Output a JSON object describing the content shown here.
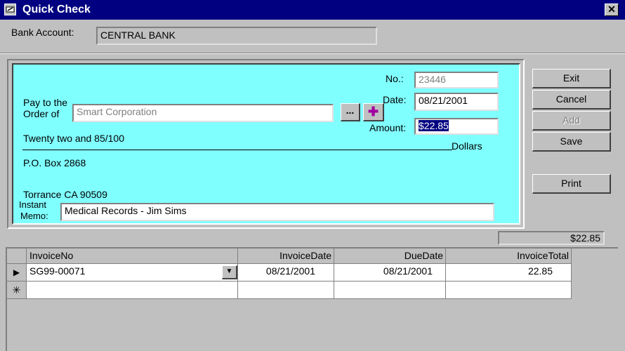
{
  "window": {
    "title": "Quick Check",
    "close_glyph": "✕"
  },
  "bank": {
    "label": "Bank Account:",
    "value": "CENTRAL BANK"
  },
  "check": {
    "no_label": "No.:",
    "no_value": "23446",
    "date_label": "Date:",
    "date_value": "08/21/2001",
    "pay_label_1": "Pay to the",
    "pay_label_2": "Order of",
    "payee_value": "Smart Corporation",
    "browse_label": "...",
    "add_payee_glyph": "✚",
    "amount_label": "Amount:",
    "amount_value": "$22.85",
    "amount_words": "Twenty two and 85/100",
    "dollars_label": "Dollars",
    "address_1": "P.O. Box 2868",
    "address_2": "Torrance CA 90509",
    "memo_label_1": "Instant",
    "memo_label_2": "Memo:",
    "memo_value": "Medical Records - Jim Sims"
  },
  "buttons": {
    "exit": "Exit",
    "cancel": "Cancel",
    "add": "Add",
    "save": "Save",
    "print": "Print"
  },
  "total": "$22.85",
  "grid": {
    "columns": [
      "InvoiceNo",
      "InvoiceDate",
      "DueDate",
      "InvoiceTotal"
    ],
    "rows": [
      {
        "invoice_no": "SG99-00071",
        "invoice_date": "08/21/2001",
        "due_date": "08/21/2001",
        "invoice_total": "22.85"
      }
    ],
    "current_row_glyph": "▶",
    "new_row_glyph": "✳",
    "dropdown_glyph": "▼"
  },
  "colors": {
    "title_bar": "#000080",
    "check_bg": "#80ffff",
    "window_bg": "#c0c0c0",
    "selection": "#000080"
  }
}
